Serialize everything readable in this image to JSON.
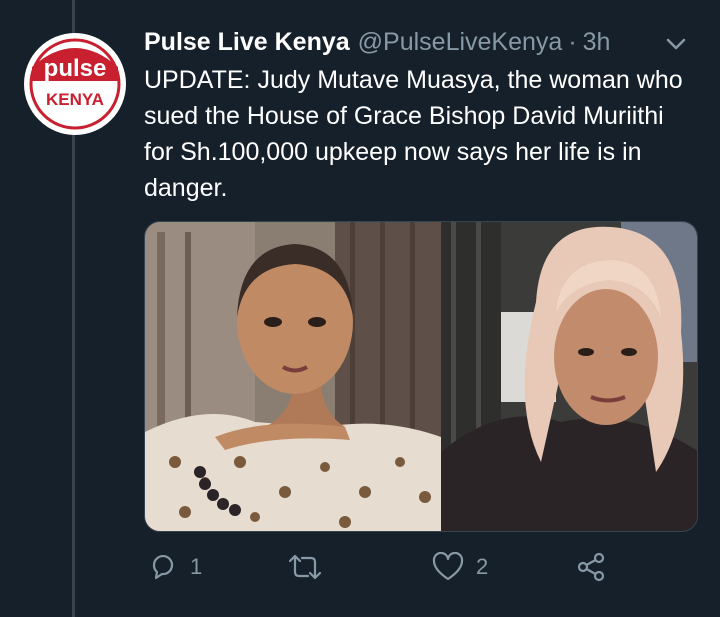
{
  "tweet": {
    "author": {
      "display_name": "Pulse Live Kenya",
      "handle": "@PulseLiveKenya",
      "avatar_logo_text": "pulse",
      "avatar_sub_text": "KENYA"
    },
    "separator": "·",
    "time": "3h",
    "text": "UPDATE: Judy Mutave Muasya, the woman who sued the House of Grace Bishop David Muriithi for Sh.100,000 upkeep now says her life is in danger.",
    "media": {
      "left_image": "photo-woman-short-hair",
      "right_image": "photo-woman-blonde-hair"
    },
    "actions": {
      "reply_count": "1",
      "retweet_count": "",
      "like_count": "2"
    }
  },
  "colors": {
    "background": "#15202b",
    "secondary_text": "#8899a6",
    "divider": "#38444d",
    "brand_red": "#c8202f"
  }
}
